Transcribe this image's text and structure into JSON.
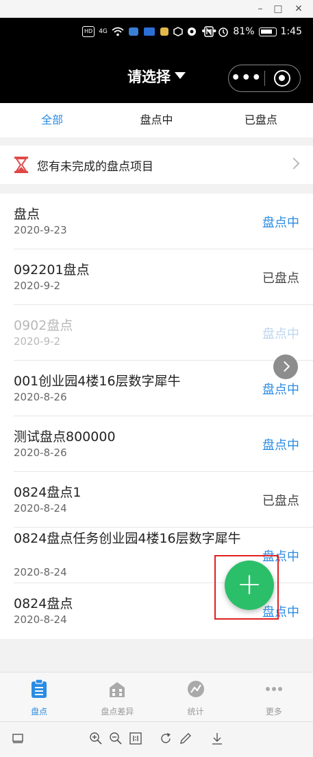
{
  "window": {
    "minimize_glyph": "–",
    "restore_glyph": "□",
    "close_glyph": "✕"
  },
  "statusbar": {
    "badges": [
      "HD",
      "4G",
      "HD"
    ],
    "battery": "81%",
    "time": "1:45"
  },
  "navbar": {
    "title": "请选择",
    "menu_dots": "•••"
  },
  "tabs": [
    {
      "label": "全部",
      "active": true
    },
    {
      "label": "盘点中",
      "active": false
    },
    {
      "label": "已盘点",
      "active": false
    }
  ],
  "banner": {
    "text": "您有未完成的盘点项目"
  },
  "items": [
    {
      "title": "盘点",
      "date": "2020-9-23",
      "status": "盘点中"
    },
    {
      "title": "092201盘点",
      "date": "2020-9-2",
      "status": "已盘点"
    },
    {
      "title": "0902盘点",
      "date": "2020-9-2",
      "status": "盘点中"
    },
    {
      "title": "001创业园4楼16层数字犀牛",
      "date": "2020-8-26",
      "status": "盘点中"
    },
    {
      "title": "测试盘点800000",
      "date": "2020-8-26",
      "status": "盘点中"
    },
    {
      "title": "0824盘点1",
      "date": "2020-8-24",
      "status": "已盘点"
    },
    {
      "title": "0824盘点任务创业园4楼16层数字犀牛",
      "date": "2020-8-24",
      "status": "盘点中"
    },
    {
      "title": "0824盘点",
      "date": "2020-8-24",
      "status": "盘点中"
    }
  ],
  "fab": {
    "label": "+"
  },
  "tabbar": [
    {
      "label": "盘点",
      "icon": "clipboard-icon",
      "active": true
    },
    {
      "label": "盘点差异",
      "icon": "building-icon",
      "active": false
    },
    {
      "label": "统计",
      "icon": "chart-icon",
      "active": false
    },
    {
      "label": "更多",
      "icon": "more-icon",
      "active": false
    }
  ],
  "colors": {
    "accent": "#2a8be3",
    "fab": "#2cbf6a",
    "highlight_box": "#e02020"
  }
}
